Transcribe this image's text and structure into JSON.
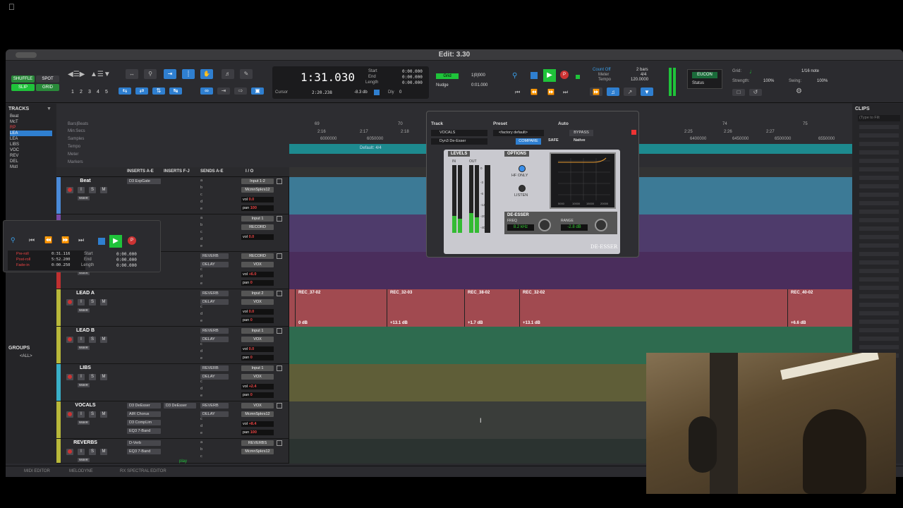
{
  "menu": {
    "apple": ""
  },
  "window": {
    "title": "Edit: 3.30"
  },
  "toolbar": {
    "modes": [
      "SHUFFLE",
      "SPOT",
      "SLIP",
      "GRID"
    ],
    "zoom_presets": [
      "1",
      "2",
      "3",
      "4",
      "5"
    ],
    "counter": {
      "main": "1:31.030",
      "start_label": "Start",
      "start": "0:00.000",
      "end_label": "End",
      "end": "0:00.000",
      "length_label": "Length",
      "length": "0:00.000",
      "cursor_label": "Cursor",
      "cursor": "2:20.238",
      "level": "-8.3 db",
      "dly_label": "Dly",
      "dly": "0"
    },
    "grid_nudge": {
      "grid_label": "Grid",
      "grid_value": "1|0|000",
      "nudge_label": "Nudge",
      "nudge_value": "0:01.000"
    },
    "count": {
      "count_off": "Count Off",
      "meter_label": "Meter",
      "tempo_label": "Tempo",
      "bars": "2 bars",
      "meter": "4/4",
      "tempo": "120.0000"
    },
    "eucon": {
      "label": "EUCON",
      "status": "Status"
    },
    "grid_panel": {
      "grid_label": "Grid:",
      "grid_value": "1/16 note",
      "strength_label": "Strength:",
      "strength": "100%",
      "swing_label": "Swing:",
      "swing": "100%"
    }
  },
  "sidebar": {
    "tracks_header": "TRACKS",
    "tracks": [
      "Beat",
      "McT",
      "RP",
      "LEA",
      "LEA",
      "LIBS",
      "VOC",
      "REV",
      "DEL",
      "Mstl"
    ],
    "groups_header": "GROUPS",
    "groups": [
      "<ALL>"
    ]
  },
  "rulers": {
    "names": [
      "Bars|Beats",
      "Min:Secs",
      "Samples",
      "Tempo",
      "Meter",
      "Markers"
    ],
    "tempo_marker": "Default: 4/4",
    "bar_numbers": [
      "69",
      "70",
      "74",
      "75"
    ],
    "minsecs": [
      "2:16",
      "2:17",
      "2:18",
      "2:25",
      "2:26",
      "2:27"
    ],
    "samples": [
      "6000000",
      "6050000",
      "6400000",
      "6450000",
      "6500000",
      "6550000"
    ]
  },
  "columns": {
    "inserts_ae": "INSERTS A-E",
    "inserts_fj": "INSERTS F-J",
    "sends_ae": "SENDS A-E",
    "io": "I / O"
  },
  "tracks": [
    {
      "name": "Beat",
      "color": "#4a8ad8",
      "inserts": [
        "D3 ExpGate"
      ],
      "sends": [],
      "input": "Input 1-2",
      "output": "McmnSpkrs12",
      "vol": "0.0",
      "pan": "100",
      "pan2": "100",
      "clip_color": "#3c7a96"
    },
    {
      "name": "",
      "color": "#7a4aa8",
      "inserts": [],
      "sends": [],
      "input": "Input 1",
      "output": "RECORD",
      "vol": "0.0",
      "pan": "",
      "pan2": "",
      "clip_color": "#4e3b6b"
    },
    {
      "name": "",
      "color": "#c03030",
      "inserts": [],
      "sends": [
        "REVERB",
        "DELAY"
      ],
      "input": "RECORD",
      "output": "VOX",
      "vol": "+6.0",
      "pan": "0",
      "pan2": "",
      "clip_color": "#4a2d5c"
    },
    {
      "name": "LEAD A",
      "color": "#b8b83a",
      "inserts": [],
      "sends": [
        "REVERB",
        "DELAY"
      ],
      "input": "Input 2",
      "output": "VOX",
      "vol": "0.0",
      "pan": "0",
      "pan2": "",
      "clip_color": "#a14a50",
      "clips": [
        {
          "name": "REC_37-02",
          "gain": "0 dB"
        },
        {
          "name": "REC_32-03",
          "gain": "+13.1 dB"
        },
        {
          "name": "REC_38-02",
          "gain": "+1.7 dB"
        },
        {
          "name": "REC_32-02",
          "gain": "+13.1 dB"
        },
        {
          "name": "REC_40-02",
          "gain": "+6.6 dB"
        }
      ]
    },
    {
      "name": "LEAD B",
      "color": "#b8b83a",
      "inserts": [],
      "sends": [
        "REVERB",
        "DELAY"
      ],
      "input": "Input 1",
      "output": "VOX",
      "vol": "0.0",
      "pan": "0",
      "pan2": "",
      "clip_color": "#2e6b4f"
    },
    {
      "name": "LIBS",
      "color": "#3ab0c8",
      "inserts": [],
      "sends": [
        "REVERB",
        "DELAY"
      ],
      "input": "Input 1",
      "output": "VOX",
      "vol": "+2.4",
      "pan": "0",
      "pan2": "",
      "clip_color": "#5f5e38"
    },
    {
      "name": "VOCALS",
      "color": "#b8b83a",
      "inserts": [
        "D3 DeEsser",
        "AIR Chorus",
        "D3 CompLim",
        "EQ3 7-Band"
      ],
      "insert_fj": "D3 DeEsser",
      "sends": [
        "REVERB",
        "DELAY"
      ],
      "input": "VOX",
      "output": "McmnSpkrs12",
      "vol": "+8.4",
      "pan": "100",
      "pan2": "100",
      "clip_color": "#3a3d3a"
    },
    {
      "name": "REVERBS",
      "color": "#b8b83a",
      "inserts": [
        "D-Verb",
        "EQ3 7-Band"
      ],
      "sends": [],
      "input": "REVERBS",
      "output": "McmnSpkrs12",
      "vol": "",
      "pan": "",
      "pan2": "",
      "clip_color": "#2b3330"
    }
  ],
  "send_letters": [
    "a",
    "b",
    "c",
    "d",
    "e"
  ],
  "vol_label": "vol",
  "pan_label": "pan",
  "wave_label": "wave",
  "status_play": "play",
  "transport_float": {
    "preroll_label": "Pre-roll",
    "preroll": "0:31.116",
    "postroll_label": "Post-roll",
    "postroll": "5:52.200",
    "fadein_label": "Fade-in",
    "fadein": "0:00.250",
    "start_label": "Start",
    "start": "0:00.000",
    "end_label": "End",
    "end": "0:00.000",
    "length_label": "Length",
    "length": "0:00.000"
  },
  "plugin": {
    "track_label": "Track",
    "track_value": "VOCALS",
    "preset_label": "Preset",
    "preset_value": "<factory default>",
    "auto_label": "Auto",
    "plugin_name": "Dyn3 De-Esser",
    "bypass": "BYPASS",
    "compare": "COMPARE",
    "safe": "SAFE",
    "native": "Native",
    "levels": "LEVELS",
    "in": "IN",
    "out": "OUT",
    "options": "OPTIONS",
    "hf_only": "HF ONLY",
    "listen": "LISTEN",
    "section": "DE-ESSER",
    "freq_label": "FREQ",
    "freq": "8.2 kHz",
    "range_label": "RANGE",
    "range": "-2.8 dB",
    "brand": "DE-ESSER",
    "meter_scale": [
      "0",
      "-3",
      "-6",
      "-12",
      "-20",
      "-40"
    ],
    "graph_axis": [
      "5000",
      "10000",
      "15000",
      "20000"
    ]
  },
  "clips_panel": {
    "header": "CLIPS",
    "search": "(Type to Filt"
  },
  "bottom_tabs": [
    "MIDI EDITOR",
    "MELODYNE",
    "RX SPECTRAL EDITOR"
  ],
  "colors": {
    "accent": "#2f7fd0",
    "green": "#1fc33a",
    "teal": "#1d8a8f"
  }
}
